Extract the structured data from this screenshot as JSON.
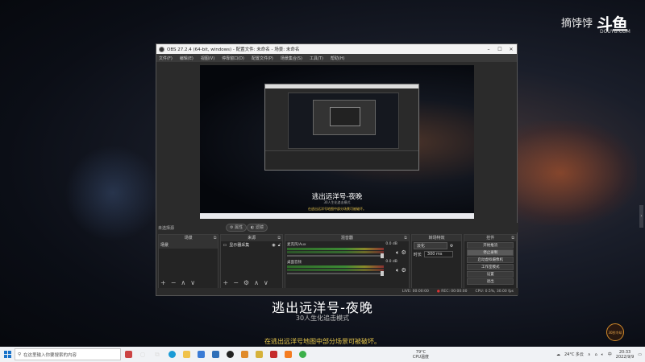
{
  "watermark": {
    "name": "摘饽饽",
    "logo": "斗鱼",
    "site": "DOUYU.COM"
  },
  "obs": {
    "title": "OBS 27.2.4 (64-bit, windows) - 配置文件: 未命名 - 场景: 未命名",
    "menu": [
      "文件(F)",
      "编辑(E)",
      "视图(V)",
      "停靠窗口(D)",
      "配置文件(P)",
      "场景集合(S)",
      "工具(T)",
      "帮助(H)"
    ],
    "preview": {
      "title": "逃出远洋号-夜晚",
      "subtitle": "30人生化追击模式",
      "notice": "在逃出远洋号地图中部分场景可被破坏。"
    },
    "toolbar": {
      "scene_label": "未选择源",
      "properties": "属性",
      "filters": "滤镜"
    },
    "docks": {
      "scenes": {
        "header": "场景",
        "items": [
          "场景"
        ]
      },
      "sources": {
        "header": "来源",
        "items": [
          "显示器采集"
        ]
      },
      "mixer": {
        "header": "混音器",
        "tracks": [
          {
            "name": "麦克风/Aux",
            "db": "0.0 dB"
          },
          {
            "name": "桌面音频",
            "db": "0.0 dB"
          }
        ]
      },
      "transitions": {
        "header": "转场特效",
        "type": "淡化",
        "duration_label": "时长",
        "duration": "300 ms"
      },
      "controls": {
        "header": "控件",
        "buttons": [
          "开始推流",
          "停止录制",
          "启动虚拟摄像机",
          "工作室模式",
          "设置",
          "退出"
        ]
      }
    },
    "status": {
      "live": "LIVE: 00:00:00",
      "rec": "REC: 00:00:00",
      "cpu": "CPU: 0.5%, 30.00 fps"
    }
  },
  "captions": {
    "title": "逃出远洋号-夜晚",
    "subtitle": "30人生化追击模式",
    "notice": "在逃出远洋号地图中部分场景可被破坏。"
  },
  "corner_badge": "30秒冷却",
  "taskbar": {
    "search_placeholder": "在这里输入你要搜索的内容",
    "cpu_temp": "79°C",
    "cpu_label": "CPU温度",
    "weather": "24°C 多云",
    "time": "20:33",
    "date": "2022/9/9",
    "ime": "中"
  }
}
